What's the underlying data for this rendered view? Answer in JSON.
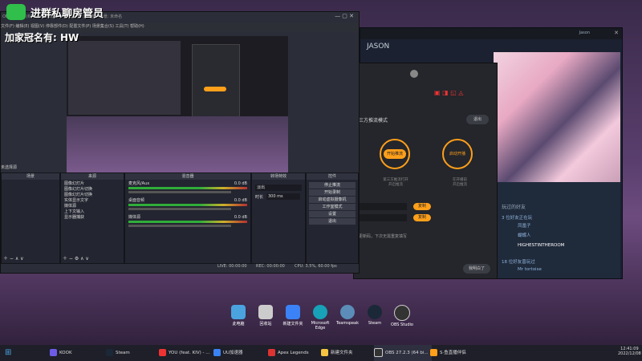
{
  "overlay": {
    "title": "进群私聊房管员",
    "sub": "加家冠名有: HW"
  },
  "steam": {
    "name": "JASON",
    "title_user": "Jason",
    "friends_header": "玩过的好友",
    "rows": [
      "3 位好友正在玩",
      "凤凰子",
      "蝴蝶人",
      "HIGHESTINTHEROOM",
      "18 位好友曾玩过",
      "Mr tortoise"
    ]
  },
  "controller": {
    "mode_label": "三方推流模式",
    "exit": "退出",
    "start_push": "开始推流",
    "start_live": "启动开播",
    "left_desc": "第三方推流打开\n开启推流",
    "right_desc": "在开播前\n开启推流",
    "copy1": "复制",
    "copy2": "复制",
    "note": "更新码，下次无需重复填写",
    "ok": "我明白了"
  },
  "obs": {
    "title": "OBS 27.2.3 (64 bit, windows) - 配置文件: 未命名 - 场景: 未命名",
    "menus": [
      "文件(F)",
      "编辑(E)",
      "视图(V)",
      "停靠部件(D)",
      "配置文件(P)",
      "场景集合(S)",
      "工具(T)",
      "帮助(H)"
    ],
    "panels": {
      "scenes": "场景",
      "sources": "来源",
      "mixer": "混音器",
      "transition": "转场特效",
      "controls": "控件"
    },
    "sources": [
      "图像幻灯片",
      "图像幻灯片切换",
      "图像幻灯片切换",
      "实体显示文字",
      "媒体源",
      "上下文输入",
      "显示器捕获"
    ],
    "mixer": [
      {
        "name": "麦克风/Aux",
        "level": "0.0 dB"
      },
      {
        "name": "桌面音频",
        "level": "0.0 dB"
      },
      {
        "name": "媒体源",
        "level": "0.0 dB"
      }
    ],
    "transition": {
      "type": "淡出",
      "duration_label": "时长",
      "duration": "300 ms"
    },
    "controls": [
      "停止推流",
      "开始录制",
      "启动虚拟摄像机",
      "工作室模式",
      "设置",
      "退出"
    ],
    "status": {
      "live": "LIVE: 00:00:00",
      "rec": "REC: 00:00:00",
      "cpu": "CPU: 3.5%, 60.00 fps"
    },
    "scene_filter": "未选择源"
  },
  "desktop_icons": [
    "此电脑",
    "回收站",
    "新建文件夹",
    "Microsoft Edge",
    "Teamspeak",
    "Steam",
    "OBS Studio"
  ],
  "taskbar": {
    "items": [
      "KOOK",
      "Steam",
      "YOU (feat. KIV) - ...",
      "UU加速器",
      "Apex Legends",
      "新建文件夹",
      "OBS 27.2.3 (64 bi...",
      "S·鱼直播伴侣"
    ],
    "time": "12:41:09",
    "date": "2022/12/08"
  },
  "colors": {
    "accent": "#ff9f1a",
    "obs_bg": "#2b2e38",
    "taskbar": "#1e1f29"
  }
}
